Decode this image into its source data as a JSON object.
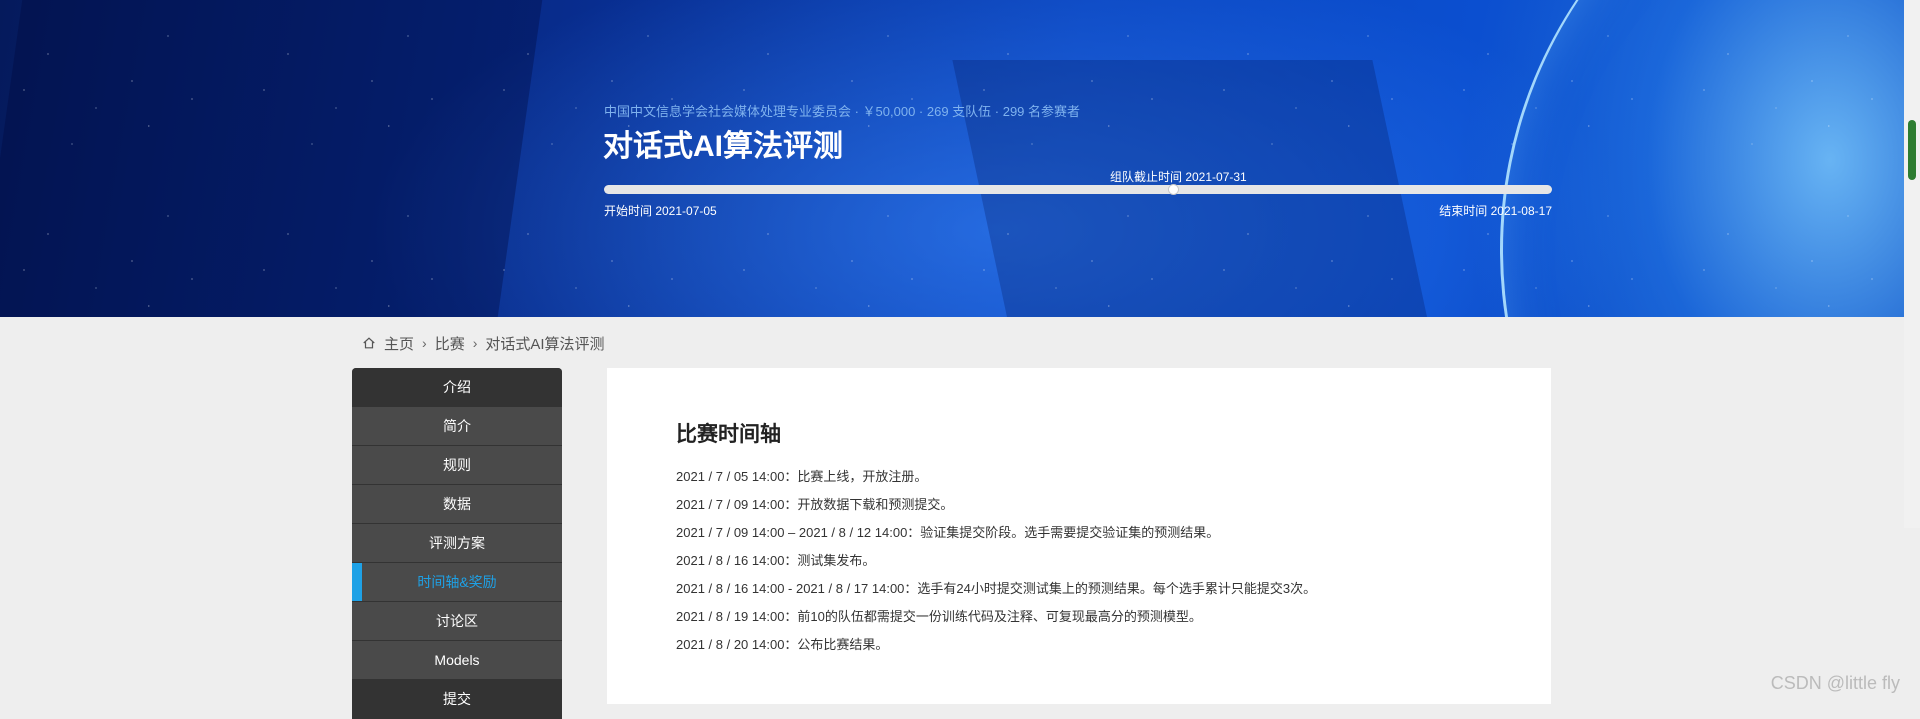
{
  "banner": {
    "subtitle": "中国中文信息学会社会媒体处理专业委员会 · ￥50,000 · 269 支队伍 · 299 名参赛者",
    "title": "对话式AI算法评测",
    "progress": {
      "start_label": "开始时间 2021-07-05",
      "end_label": "结束时间 2021-08-17",
      "deadline_label": "组队截止时间 2021-07-31",
      "deadline_fraction": 0.6
    }
  },
  "breadcrumb": {
    "home": "主页",
    "level1": "比赛",
    "level2": "对话式AI算法评测"
  },
  "sidebar": {
    "items": [
      {
        "label": "介绍",
        "style": "dark"
      },
      {
        "label": "简介",
        "style": "normal"
      },
      {
        "label": "规则",
        "style": "normal"
      },
      {
        "label": "数据",
        "style": "normal"
      },
      {
        "label": "评测方案",
        "style": "normal"
      },
      {
        "label": "时间轴&奖励",
        "style": "active"
      },
      {
        "label": "讨论区",
        "style": "normal"
      },
      {
        "label": "Models",
        "style": "normal"
      },
      {
        "label": "提交",
        "style": "dark"
      }
    ]
  },
  "panel": {
    "heading": "比赛时间轴",
    "timeline": [
      "2021 / 7 / 05 14:00：比赛上线，开放注册。",
      "2021 / 7 / 09 14:00：开放数据下载和预测提交。",
      "2021 / 7 / 09 14:00 – 2021 / 8 / 12 14:00：验证集提交阶段。选手需要提交验证集的预测结果。",
      "2021 / 8 / 16 14:00：测试集发布。",
      "2021 / 8 / 16 14:00 - 2021 / 8 / 17 14:00：选手有24小时提交测试集上的预测结果。每个选手累计只能提交3次。",
      "2021 / 8 / 19 14:00：前10的队伍都需提交一份训练代码及注释、可复现最高分的预测模型。",
      "2021 / 8 / 20 14:00：公布比赛结果。"
    ]
  },
  "watermark": "CSDN @little fly",
  "colors": {
    "accent": "#1ea1e6",
    "sidebar_bg": "#4a4a4a",
    "sidebar_dark": "#333333"
  }
}
